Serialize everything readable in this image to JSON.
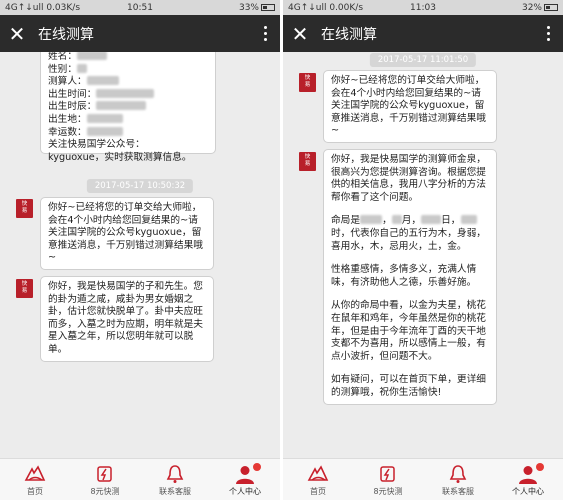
{
  "left": {
    "status": {
      "left": "4G↑↓ull 0.03K/s",
      "time": "10:51",
      "right": "33%"
    },
    "header": {
      "title": "在线测算"
    },
    "info_box": {
      "lines": [
        {
          "label": "姓名："
        },
        {
          "label": "性别："
        },
        {
          "label": "测算人："
        },
        {
          "label": "出生时间："
        },
        {
          "label": "出生时辰："
        },
        {
          "label": "出生地："
        },
        {
          "label": "幸运数："
        }
      ],
      "footer_1": "关注快易国学公众号：",
      "footer_2": "kyguoxue，实时获取测算信息。"
    },
    "timestamp": "2017-05-17 10:50:32",
    "msg1": "你好~已经将您的订单交给大师啦，会在4个小时内给您回复结果的~请关注国学院的公众号kyguoxue，留意推送消息，千万别错过测算结果哦~",
    "msg2": "你好，我是快易国学的子和先生。您的卦为遁之咸，咸卦为男女婚姻之卦，估计您就快脱单了。卦中夫应旺而多，入墓之时为应期，明年就是夫星入墓之年，所以您明年就可以脱单。"
  },
  "right": {
    "status": {
      "left": "4G↑↓ull 0.00K/s",
      "time": "11:03",
      "right": "32%"
    },
    "header": {
      "title": "在线测算"
    },
    "timestamp": "2017-05-17 11:01:50",
    "msg1": "你好~已经将您的订单交给大师啦，会在4个小时内给您回复结果的~请关注国学院的公众号kyguoxue，留意推送消息，千万别错过测算结果哦~",
    "msg2_intro": "你好，我是快易国学的测算师金泉，很高兴为您提供测算咨询。根据您提供的相关信息，我用八字分析的方法帮你看了这个问题。",
    "msg2_p2a": "命局是",
    "msg2_p2b": "，",
    "msg2_p2c": "月，",
    "msg2_p2d": "日，",
    "msg2_p2e": "时，代表你自己的五行为木，身弱，喜用水，木，忌用火，土，金。",
    "msg2_p3": "性格重感情，多情多义，充满人情味，有济助他人之德，乐善好施。",
    "msg2_p4": "从你的命局中看，以金为夫星，桃花在鼠年和鸡年，今年虽然是你的桃花年，但是由于今年流年丁酉的天干地支都不为喜用，所以感情上一般，有点小波折，但问题不大。",
    "msg2_p5": "如有疑问，可以在首页下单，更详细的测算哦，祝你生活愉快!"
  },
  "avatar_text": [
    "快",
    "易"
  ],
  "tabs": [
    {
      "label": "首页",
      "icon": "home-icon"
    },
    {
      "label": "8元快测",
      "icon": "quick-test-icon"
    },
    {
      "label": "联系客服",
      "icon": "bell-icon"
    },
    {
      "label": "个人中心",
      "icon": "user-icon"
    }
  ],
  "colors": {
    "accent": "#c8202c",
    "header": "#2b2b2b",
    "badge": "#e53935"
  }
}
